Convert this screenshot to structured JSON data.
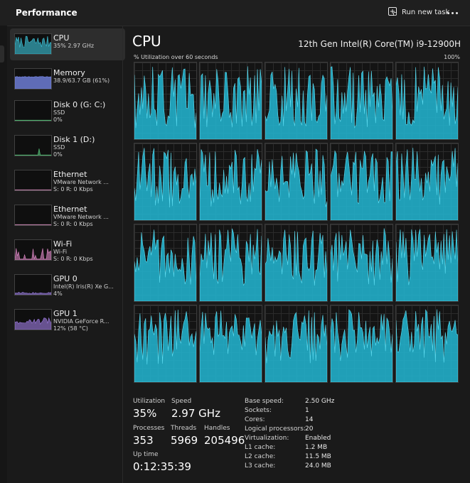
{
  "header": {
    "title": "Performance",
    "run_task_label": "Run new task",
    "run_task_icon": "run-task-icon",
    "more_icon": "more-options-icon"
  },
  "sidebar": {
    "items": [
      {
        "name": "CPU",
        "sub1": "35% 2.97 GHz",
        "sub2": "",
        "sub3": "",
        "color": "#3ec8de",
        "active": true
      },
      {
        "name": "Memory",
        "sub1": "38.9/63.7 GB (61%)",
        "sub2": "",
        "sub3": "",
        "color": "#7b8cf0",
        "active": false
      },
      {
        "name": "Disk 0 (G: C:)",
        "sub1": "SSD",
        "sub2": "0%",
        "sub3": "",
        "color": "#58c47a",
        "active": false
      },
      {
        "name": "Disk 1 (D:)",
        "sub1": "SSD",
        "sub2": "0%",
        "sub3": "",
        "color": "#58c47a",
        "active": false
      },
      {
        "name": "Ethernet",
        "sub1": "VMware Network ...",
        "sub2": "S: 0 R: 0 Kbps",
        "sub3": "",
        "color": "#d08ab8",
        "active": false
      },
      {
        "name": "Ethernet",
        "sub1": "VMware Network ...",
        "sub2": "S: 0 R: 0 Kbps",
        "sub3": "",
        "color": "#d08ab8",
        "active": false
      },
      {
        "name": "Wi-Fi",
        "sub1": "Wi-Fi",
        "sub2": "S: 0 R: 0 Kbps",
        "sub3": "",
        "color": "#e08ac8",
        "active": false
      },
      {
        "name": "GPU 0",
        "sub1": "Intel(R) Iris(R) Xe G...",
        "sub2": "4%",
        "sub3": "",
        "color": "#9b7ee0",
        "active": false
      },
      {
        "name": "GPU 1",
        "sub1": "NVIDIA GeForce R...",
        "sub2": "12% (58 °C)",
        "sub3": "",
        "color": "#a27ee6",
        "active": false
      }
    ]
  },
  "main": {
    "title": "CPU",
    "cpu_model": "12th Gen Intel(R) Core(TM) i9-12900H",
    "graph_label": "% Utilization over 60 seconds",
    "graph_max_label": "100%",
    "graph_color": "#22b7d4",
    "logical_processor_graphs": 20
  },
  "stats": {
    "utilization_label": "Utilization",
    "utilization_value": "35%",
    "speed_label": "Speed",
    "speed_value": "2.97 GHz",
    "processes_label": "Processes",
    "processes_value": "353",
    "threads_label": "Threads",
    "threads_value": "5969",
    "handles_label": "Handles",
    "handles_value": "205496",
    "uptime_label": "Up time",
    "uptime_value": "0:12:35:39"
  },
  "details": [
    {
      "label": "Base speed:",
      "value": "2.50 GHz"
    },
    {
      "label": "Sockets:",
      "value": "1"
    },
    {
      "label": "Cores:",
      "value": "14"
    },
    {
      "label": "Logical processors:",
      "value": "20"
    },
    {
      "label": "Virtualization:",
      "value": "Enabled"
    },
    {
      "label": "L1 cache:",
      "value": "1.2 MB"
    },
    {
      "label": "L2 cache:",
      "value": "11.5 MB"
    },
    {
      "label": "L3 cache:",
      "value": "24.0 MB"
    }
  ]
}
